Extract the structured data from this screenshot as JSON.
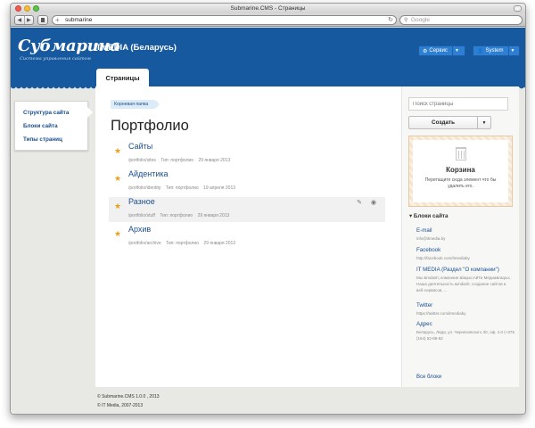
{
  "browser": {
    "window_title": "Submarine.CMS - Страницы",
    "url": "submarine",
    "search_placeholder": "Google"
  },
  "header": {
    "logo": "Субмарина",
    "tagline": "Система управления сайтом",
    "site_name": "ITMEDIA (Беларусь)",
    "service_button": "Сервис",
    "system_button": "System",
    "active_tab": "Страницы"
  },
  "sidebar": {
    "items": [
      {
        "label": "Структура сайта"
      },
      {
        "label": "Блоки сайта"
      },
      {
        "label": "Типы страниц"
      }
    ]
  },
  "main": {
    "breadcrumb": "Корневая папка",
    "title": "Портфолио",
    "pages": [
      {
        "title": "Сайты",
        "path": "/portfolio/sites",
        "type": "Тип: портфолио",
        "date": "29 января 2013"
      },
      {
        "title": "Айдентика",
        "path": "/portfolio/identity",
        "type": "Тип: портфолио",
        "date": "19 апреля 2013"
      },
      {
        "title": "Разное",
        "path": "/portfolio/stuff",
        "type": "Тип: портфолио",
        "date": "29 января 2013"
      },
      {
        "title": "Архив",
        "path": "/portfolio/archive",
        "type": "Тип: портфолио",
        "date": "29 января 2013"
      }
    ]
  },
  "right_panel": {
    "search_placeholder": "Поиск страницы",
    "create_button": "Создать",
    "trash_title": "Корзина",
    "trash_hint": "Перетащите сюда элемент что бы удалить его.",
    "blocks_heading": "Блоки сайта",
    "blocks": [
      {
        "title": "E-mail",
        "desc": "info@itmedia.by"
      },
      {
        "title": "Facebook",
        "desc": "http://facebook.com/itmediaby"
      },
      {
        "title": "IT MEDIA (Раздел \"О компании\")",
        "desc": "Мы &mdash; компания &laquo;АйТи Медиа&raquo;. Наша деятельность &mdash; создание сайтов и веб-сервисов, ..."
      },
      {
        "title": "Twitter",
        "desc": "https://twitter.com/itmediaby"
      },
      {
        "title": "Адрес",
        "desc": "Беларусь, Лида, ул. Черняховского 30, оф. 4.0 (+375 (154) 52-88-82"
      }
    ],
    "all_blocks_link": "Все блоки"
  },
  "footer": {
    "line1": "© Submarine.CMS 1.0.0 , 2013",
    "line2": "© IT Media, 2007-2013"
  }
}
